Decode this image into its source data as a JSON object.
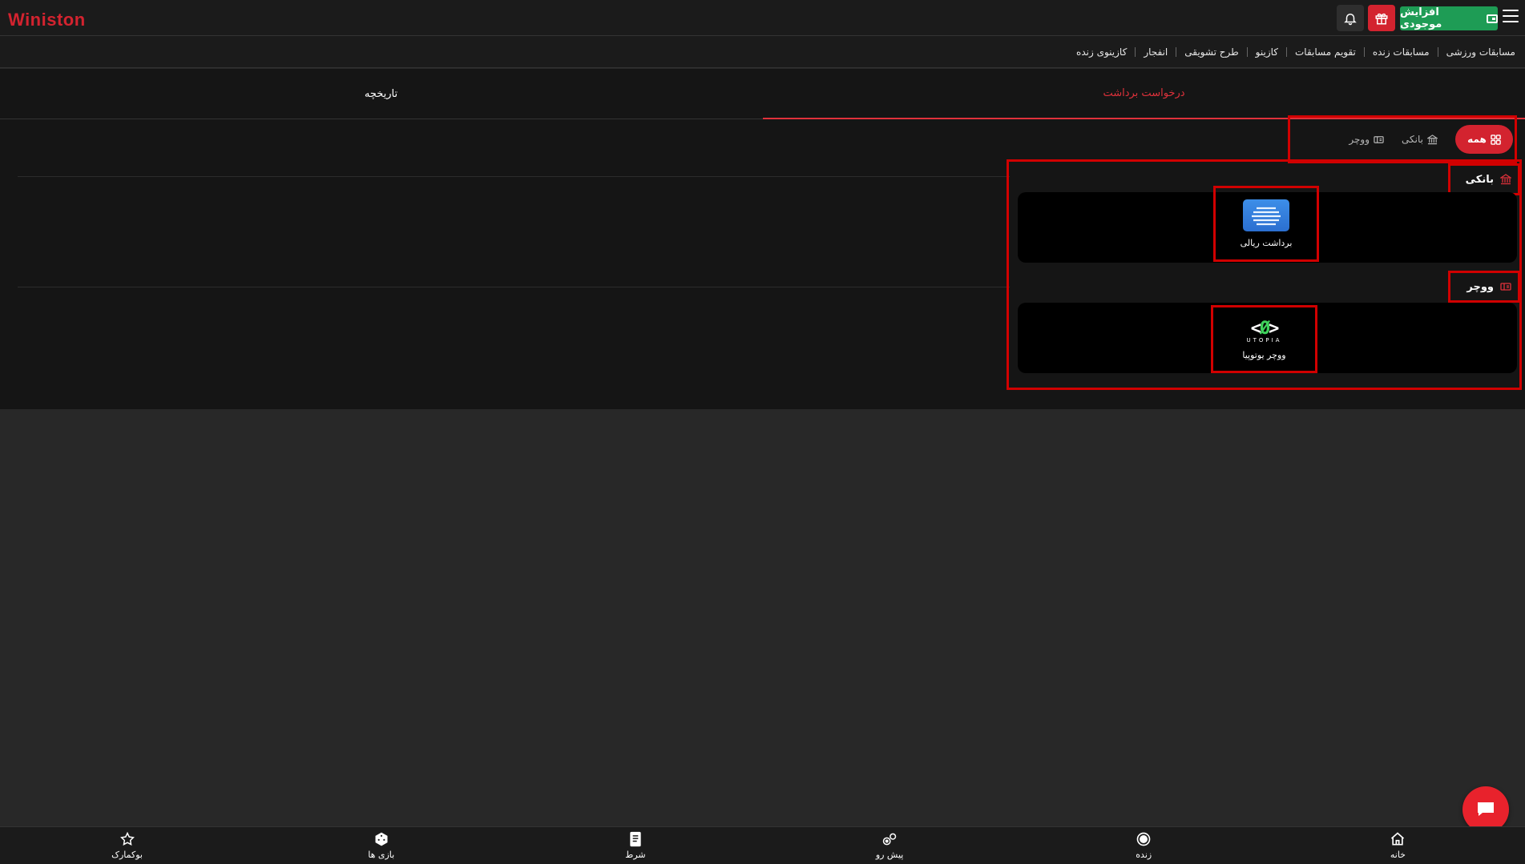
{
  "header": {
    "logo_text": "Winiston",
    "deposit_label": "افزایش موجودی",
    "icons": [
      "menu-icon",
      "wallet-icon",
      "gift-icon",
      "bell-icon"
    ]
  },
  "nav": {
    "links": [
      "مسابقات ورزشی",
      "مسابقات زنده",
      "تقویم مسابقات",
      "کازینو",
      "طرح تشویقی",
      "انفجار",
      "کازینوی زنده"
    ]
  },
  "tabs": {
    "withdraw": "درخواست برداشت",
    "history": "تاریخچه"
  },
  "filters": {
    "all": "همه",
    "bank": "بانکی",
    "voucher": "ووچر"
  },
  "sections": {
    "bank_title": "بانکی",
    "voucher_title": "ووچر"
  },
  "methods": {
    "rial_label": "برداشت ریالی",
    "utopia_label": "ووچر یوتوپیا",
    "utopia_logo_text": "UTOPIA"
  },
  "bottom_nav": {
    "home": "خانه",
    "live": "زنده",
    "prematch": "پیش رو",
    "bets": "شرط",
    "games": "بازی ها",
    "bookmarks": "بوکمارک"
  },
  "colors": {
    "accent": "#d3232f",
    "deposit": "#1e9c55",
    "annotation": "#d10000"
  }
}
